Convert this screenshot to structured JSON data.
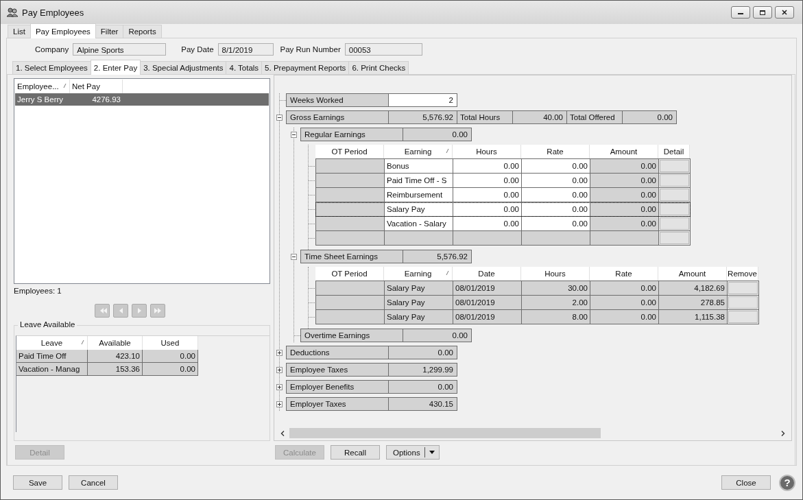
{
  "window": {
    "title": "Pay Employees"
  },
  "tabs": [
    {
      "label": "List",
      "selected": false
    },
    {
      "label": "Pay Employees",
      "selected": true
    },
    {
      "label": "Filter",
      "selected": false
    },
    {
      "label": "Reports",
      "selected": false
    }
  ],
  "header_fields": [
    {
      "label": "Company",
      "value": "Alpine Sports"
    },
    {
      "label": "Pay Date",
      "value": "8/1/2019"
    },
    {
      "label": "Pay Run Number",
      "value": "00053"
    }
  ],
  "step_tabs": [
    {
      "label": "1. Select Employees",
      "selected": false
    },
    {
      "label": "2. Enter Pay",
      "selected": true
    },
    {
      "label": "3. Special Adjustments",
      "selected": false
    },
    {
      "label": "4. Totals",
      "selected": false
    },
    {
      "label": "5. Prepayment Reports",
      "selected": false
    },
    {
      "label": "6. Print Checks",
      "selected": false
    }
  ],
  "employees": {
    "columns": [
      {
        "label": "Employee...",
        "sorted": true
      },
      {
        "label": "Net Pay",
        "sorted": false
      }
    ],
    "rows": [
      {
        "name": "Jerry S Berry",
        "net_pay": "4276.93",
        "selected": true
      }
    ],
    "count": "Employees: 1"
  },
  "nav_buttons": [
    {
      "kind": "first",
      "disabled": true
    },
    {
      "kind": "previous",
      "disabled": true
    },
    {
      "kind": "next",
      "disabled": true
    },
    {
      "kind": "last",
      "disabled": true
    }
  ],
  "leave": {
    "title": "Leave Available",
    "columns": [
      {
        "label": "Leave",
        "sorted": true
      },
      {
        "label": "Available",
        "sorted": false
      },
      {
        "label": "Used",
        "sorted": false
      }
    ],
    "rows": [
      {
        "leave": "Paid Time Off",
        "available": "423.10",
        "used": "0.00"
      },
      {
        "leave": "Vacation - Manag",
        "available": "153.36",
        "used": "0.00"
      }
    ]
  },
  "detail_button": {
    "label": "Detail",
    "disabled": true
  },
  "pay_tree": {
    "weeks_worked": {
      "label": "Weeks Worked",
      "value": "2"
    },
    "gross": {
      "label": "Gross Earnings",
      "value": "5,576.92",
      "expanded": true,
      "extras": [
        {
          "label": "Total Hours",
          "value": "40.00"
        },
        {
          "label": "Total Offered",
          "value": "0.00"
        }
      ],
      "children": [
        {
          "kind": "table",
          "label": "Regular Earnings",
          "value": "0.00",
          "expanded": true,
          "table": {
            "new_row": true,
            "columns": [
              {
                "label": "OT Period",
                "kind": "ot",
                "sorted": false
              },
              {
                "label": "Earning",
                "kind": "text",
                "sorted": true,
                "editable": true
              },
              {
                "label": "Hours",
                "kind": "number",
                "sorted": false,
                "editable": true
              },
              {
                "label": "Rate",
                "kind": "number",
                "sorted": false,
                "editable": true
              },
              {
                "label": "Amount",
                "kind": "number",
                "sorted": false,
                "editable": false
              },
              {
                "label": "Detail",
                "kind": "button",
                "sorted": false
              }
            ],
            "rows": [
              {
                "values": [
                  "Bonus",
                  "0.00",
                  "0.00",
                  "0.00"
                ],
                "focused": false
              },
              {
                "values": [
                  "Paid Time Off - S",
                  "0.00",
                  "0.00",
                  "0.00"
                ],
                "focused": false
              },
              {
                "values": [
                  "Reimbursement",
                  "0.00",
                  "0.00",
                  "0.00"
                ],
                "focused": false
              },
              {
                "values": [
                  "Salary Pay",
                  "0.00",
                  "0.00",
                  "0.00"
                ],
                "focused": true
              },
              {
                "values": [
                  "Vacation - Salary",
                  "0.00",
                  "0.00",
                  "0.00"
                ],
                "focused": false
              }
            ]
          }
        },
        {
          "kind": "table",
          "label": "Time Sheet Earnings",
          "value": "5,576.92",
          "expanded": true,
          "table": {
            "columns": [
              {
                "label": "OT Period",
                "kind": "ot",
                "sorted": false
              },
              {
                "label": "Earning",
                "kind": "text",
                "sorted": true,
                "editable": false
              },
              {
                "label": "Date",
                "kind": "text",
                "sorted": false,
                "editable": false
              },
              {
                "label": "Hours",
                "kind": "number",
                "sorted": false,
                "editable": false
              },
              {
                "label": "Rate",
                "kind": "number",
                "sorted": false,
                "editable": false
              },
              {
                "label": "Amount",
                "kind": "number",
                "sorted": false,
                "editable": false
              },
              {
                "label": "Remove",
                "kind": "button",
                "sorted": false
              }
            ],
            "rows": [
              {
                "values": [
                  "Salary Pay",
                  "08/01/2019",
                  "30.00",
                  "0.00",
                  "4,182.69"
                ],
                "focused": false
              },
              {
                "values": [
                  "Salary Pay",
                  "08/01/2019",
                  "2.00",
                  "0.00",
                  "278.85"
                ],
                "focused": false
              },
              {
                "values": [
                  "Salary Pay",
                  "08/01/2019",
                  "8.00",
                  "0.00",
                  "1,115.38"
                ],
                "focused": false
              }
            ]
          }
        },
        {
          "kind": "plain",
          "label": "Overtime Earnings",
          "value": "0.00"
        }
      ]
    },
    "sections": [
      {
        "label": "Deductions",
        "value": "0.00",
        "expanded": false
      },
      {
        "label": "Employee Taxes",
        "value": "1,299.99",
        "expanded": false
      },
      {
        "label": "Employer Benefits",
        "value": "0.00",
        "expanded": false
      },
      {
        "label": "Employer Taxes",
        "value": "430.15",
        "expanded": false
      }
    ]
  },
  "action_buttons": [
    {
      "label": "Calculate",
      "disabled": true,
      "kind": "plain"
    },
    {
      "label": "Recall",
      "disabled": false,
      "kind": "plain"
    },
    {
      "label": "Options",
      "disabled": false,
      "kind": "split"
    }
  ],
  "footer_buttons": {
    "left": [
      {
        "label": "Save"
      },
      {
        "label": "Cancel"
      }
    ],
    "right": [
      {
        "label": "Close"
      }
    ]
  },
  "help_button": {
    "glyph": "?"
  }
}
